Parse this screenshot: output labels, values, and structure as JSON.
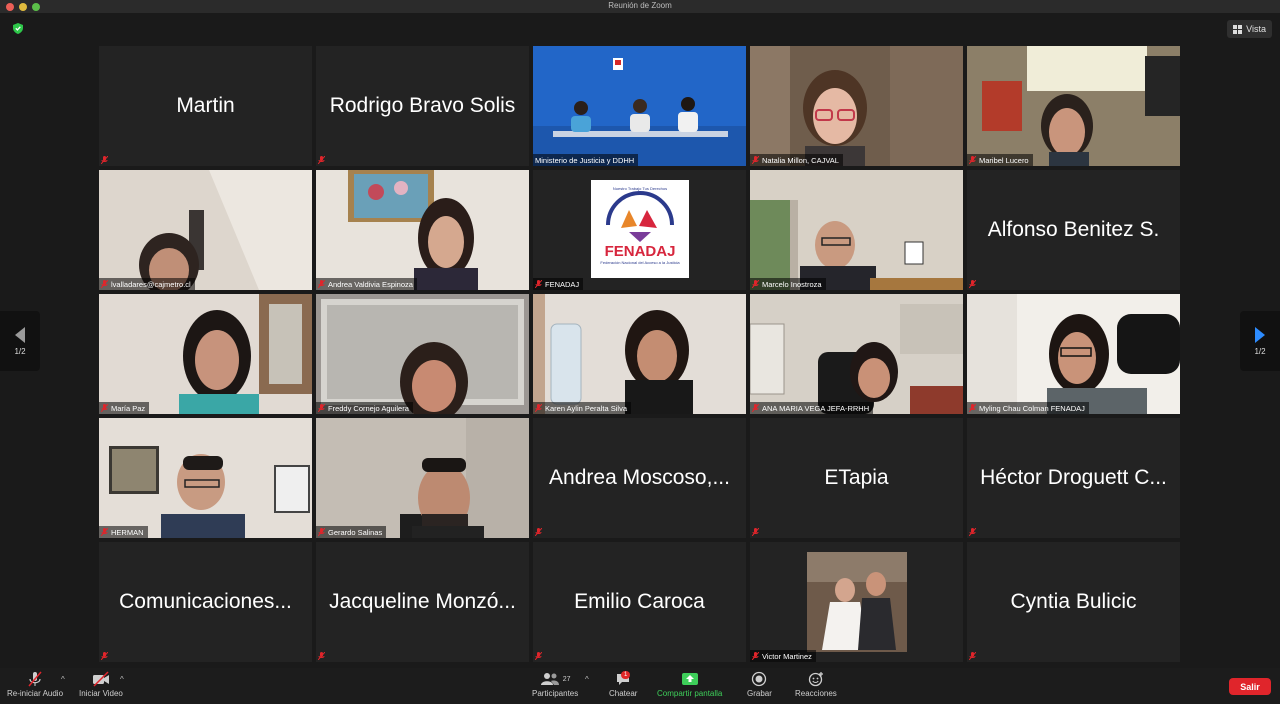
{
  "window": {
    "title": "Reunión de Zoom"
  },
  "top": {
    "view_label": "Vista"
  },
  "pager": {
    "left": "1/2",
    "right": "1/2"
  },
  "tiles": [
    {
      "name": "Martin",
      "big": "Martin"
    },
    {
      "name": "Rodrigo Bravo Solis",
      "big": "Rodrigo Bravo Solis"
    },
    {
      "name": "Ministerio de Justicia y DDHH",
      "video": "conference"
    },
    {
      "name": "Natalia Millon, CAJVAL",
      "video": "woman"
    },
    {
      "name": "Maribel Lucero",
      "video": "woman-room"
    },
    {
      "name": "lvalladares@cajmetro.cl",
      "video": "woman-low"
    },
    {
      "name": "Andrea Valdivia Espinoza",
      "video": "woman-painting"
    },
    {
      "name": "FENADAJ",
      "video": "logo",
      "logo_text": "FENADAJ",
      "logo_subtitle": "Federación Nacional del Acceso a la Justicia",
      "logo_arc": "Nuestro Trabajo Tus Derechos"
    },
    {
      "name": "Marcelo Inostroza",
      "video": "man-window"
    },
    {
      "name": "Alfonso Benitez S.",
      "big": "Alfonso Benitez S."
    },
    {
      "name": "María Paz",
      "video": "woman"
    },
    {
      "name": "Freddy Cornejo Aguilera",
      "video": "woman-mirror"
    },
    {
      "name": "Karen Aylin Peralta Silva",
      "video": "woman-curly"
    },
    {
      "name": "ANA MARIA VEGA JEFA-RRHH",
      "video": "woman-office"
    },
    {
      "name": "Myling Chau Colman FENADAJ",
      "video": "woman-glasses"
    },
    {
      "name": "HERMAN",
      "video": "man-glasses"
    },
    {
      "name": "Gerardo Salinas",
      "video": "man-beard"
    },
    {
      "name": "Andrea Moscoso,...",
      "big": "Andrea Moscoso,..."
    },
    {
      "name": "ETapia",
      "big": "ETapia"
    },
    {
      "name": "Héctor Droguett C...",
      "big": "Héctor Droguett C..."
    },
    {
      "name": "Comunicaciones...",
      "big": "Comunicaciones..."
    },
    {
      "name": "Jacqueline Monzó...",
      "big": "Jacqueline Monzó..."
    },
    {
      "name": "Emilio Caroca",
      "big": "Emilio Caroca"
    },
    {
      "name": "Victor Martinez",
      "video": "wedding-photo"
    },
    {
      "name": "Cyntia Bulicic",
      "big": "Cyntia Bulicic"
    }
  ],
  "toolbar": {
    "audio_label": "Re-iniciar Audio",
    "video_label": "Iniciar Video",
    "participants_label": "Participantes",
    "participants_count": "27",
    "chat_label": "Chatear",
    "chat_badge": "1",
    "share_label": "Compartir pantalla",
    "record_label": "Grabar",
    "reactions_label": "Reacciones",
    "exit_label": "Salir"
  },
  "colors": {
    "active_speaker_border": "#d8e250",
    "share_green": "#3ecf5a",
    "exit_red": "#e0252b",
    "muted_red": "#e0252b",
    "pager_blue": "#2d8cff"
  }
}
